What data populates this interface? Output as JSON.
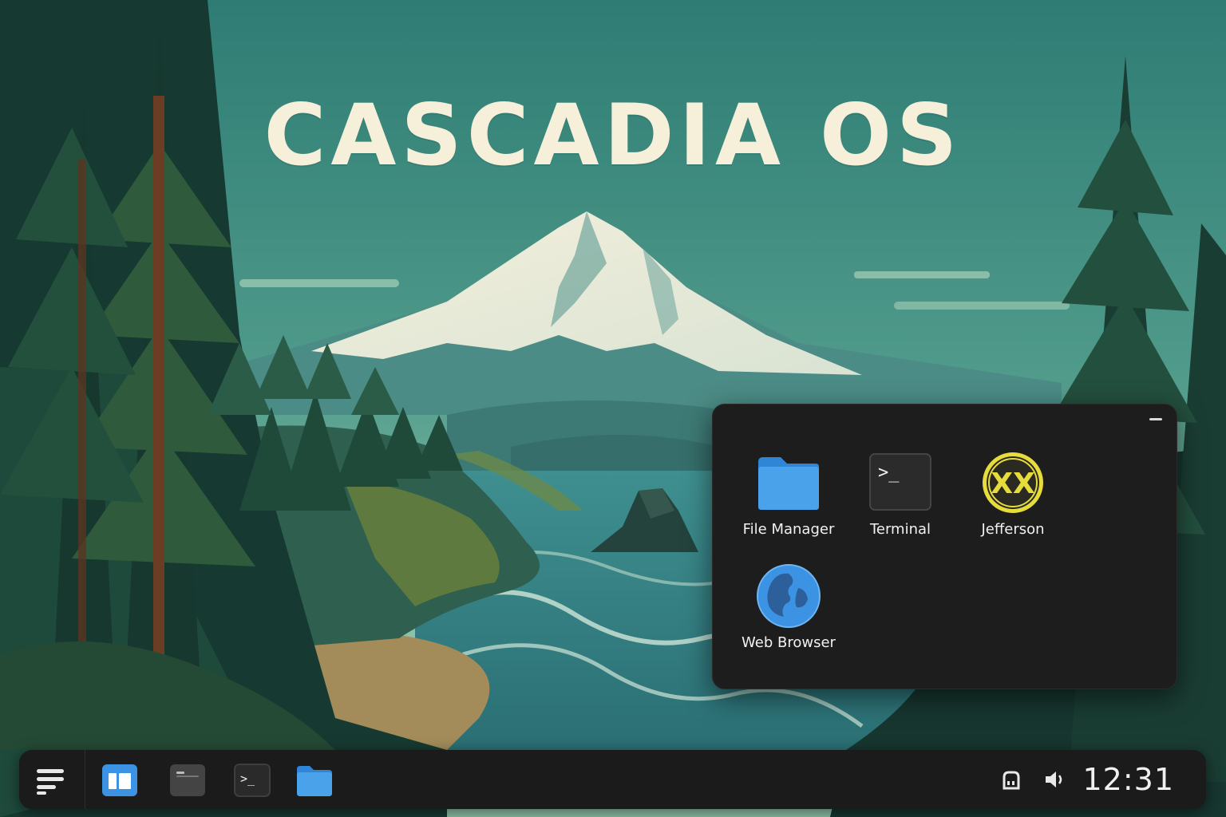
{
  "desktop": {
    "brand_title": "CASCADIA OS"
  },
  "launcher": {
    "apps": [
      {
        "label": "File Manager",
        "icon": "folder-icon"
      },
      {
        "label": "Terminal",
        "icon": "terminal-icon"
      },
      {
        "label": "Jefferson",
        "icon": "jefferson-xx-icon",
        "glyph": "XX"
      },
      {
        "label": "Web Browser",
        "icon": "globe-icon"
      }
    ],
    "terminal_prompt": ">_"
  },
  "taskbar": {
    "items": [
      {
        "name": "app-menu",
        "icon": "menu-lines-icon"
      },
      {
        "name": "workspace-switcher",
        "icon": "window-overview-icon",
        "active": true
      },
      {
        "name": "window",
        "icon": "window-icon"
      },
      {
        "name": "terminal",
        "icon": "terminal-icon"
      },
      {
        "name": "files",
        "icon": "folder-icon"
      }
    ],
    "tray": [
      {
        "name": "network",
        "icon": "network-icon"
      },
      {
        "name": "volume",
        "icon": "volume-icon"
      }
    ],
    "clock": "12:31",
    "terminal_prompt": ">_"
  },
  "colors": {
    "accent_blue": "#3d93e3",
    "folder_blue": "#4aa3ea",
    "jefferson_yellow": "#e6dc3c",
    "panel_bg": "#1d1d1d",
    "taskbar_bg": "#1b1b1b"
  }
}
